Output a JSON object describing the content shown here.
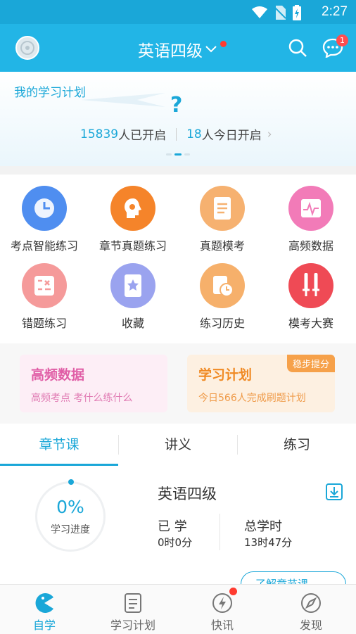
{
  "status_bar": {
    "time": "2:27"
  },
  "header": {
    "title": "英语四级",
    "message_badge": "1"
  },
  "banner": {
    "title": "我的学习计划",
    "question_mark": "?",
    "started_count": "15839",
    "started_label": "人已开启",
    "today_count": "18",
    "today_label": "人今日开启"
  },
  "features": [
    {
      "label": "考点智能练习",
      "icon": "clock-chart-icon",
      "color": "#4f8ef0"
    },
    {
      "label": "章节真题练习",
      "icon": "brain-gear-icon",
      "color": "#f5842a"
    },
    {
      "label": "真题模考",
      "icon": "document-icon",
      "color": "#f6b170"
    },
    {
      "label": "高频数据",
      "icon": "pulse-chart-icon",
      "color": "#f27bb8"
    },
    {
      "label": "错题练习",
      "icon": "error-list-icon",
      "color": "#f59a9a"
    },
    {
      "label": "收藏",
      "icon": "star-book-icon",
      "color": "#9aa3ef"
    },
    {
      "label": "练习历史",
      "icon": "history-clock-icon",
      "color": "#f6b06b"
    },
    {
      "label": "模考大赛",
      "icon": "crossed-swords-icon",
      "color": "#ef4a55"
    }
  ],
  "cards": [
    {
      "title": "高频数据",
      "subtitle": "高频考点 考什么练什么"
    },
    {
      "title": "学习计划",
      "subtitle": "今日566人完成刷题计划",
      "tag": "稳步提分"
    }
  ],
  "tabs": [
    "章节课",
    "讲义",
    "练习"
  ],
  "course": {
    "progress_value": "0%",
    "progress_label": "学习进度",
    "title": "英语四级",
    "learned_label": "已 学",
    "learned_value": "0时0分",
    "total_label": "总学时",
    "total_value": "13时47分",
    "learn_button": "了解章节课"
  },
  "bottom_nav": [
    "自学",
    "学习计划",
    "快讯",
    "发现"
  ],
  "colors": {
    "primary": "#22b5e6",
    "accent": "#1aa7d8",
    "badge": "#ff4d4f"
  }
}
